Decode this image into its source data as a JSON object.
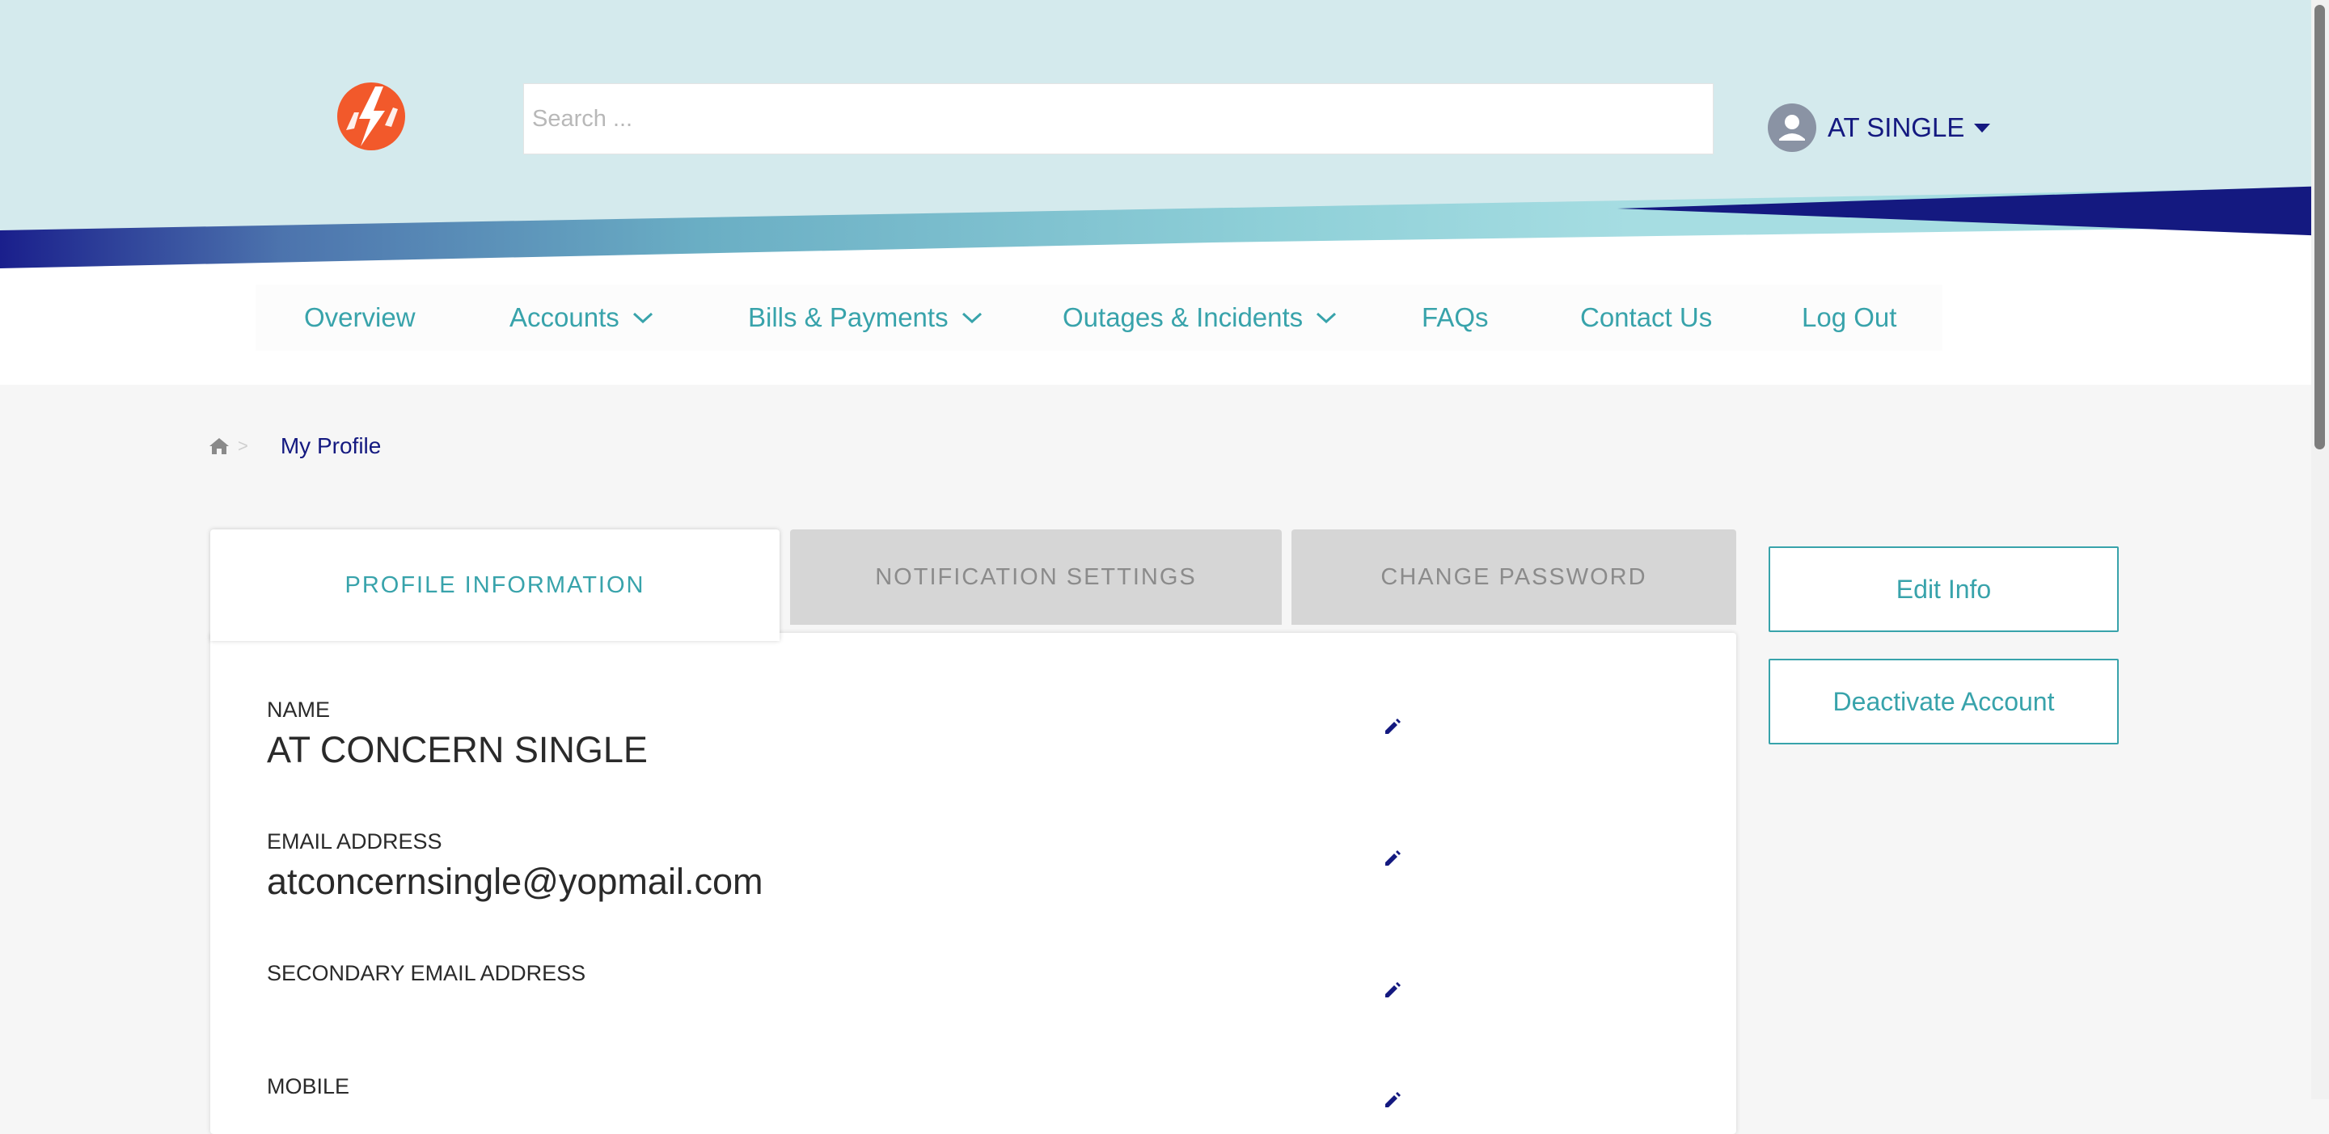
{
  "header": {
    "search_placeholder": "Search ...",
    "user_name": "AT SINGLE"
  },
  "nav": [
    {
      "label": "Overview",
      "has_dropdown": false
    },
    {
      "label": "Accounts",
      "has_dropdown": true
    },
    {
      "label": "Bills & Payments",
      "has_dropdown": true
    },
    {
      "label": "Outages & Incidents",
      "has_dropdown": true
    },
    {
      "label": "FAQs",
      "has_dropdown": false
    },
    {
      "label": "Contact Us",
      "has_dropdown": false
    },
    {
      "label": "Log Out",
      "has_dropdown": false
    }
  ],
  "breadcrumb": {
    "separator": ">",
    "current": "My Profile"
  },
  "tabs": [
    {
      "label": "PROFILE INFORMATION",
      "active": true
    },
    {
      "label": "NOTIFICATION SETTINGS",
      "active": false
    },
    {
      "label": "CHANGE PASSWORD",
      "active": false
    }
  ],
  "profile": {
    "fields": [
      {
        "label": "NAME",
        "value": "AT CONCERN SINGLE"
      },
      {
        "label": "EMAIL ADDRESS",
        "value": "atconcernsingle@yopmail.com"
      },
      {
        "label": "SECONDARY EMAIL ADDRESS",
        "value": ""
      },
      {
        "label": "MOBILE",
        "value": ""
      }
    ]
  },
  "actions": {
    "edit_info": "Edit Info",
    "deactivate": "Deactivate Account"
  },
  "colors": {
    "brand_navy": "#141980",
    "accent_teal": "#38a3ab",
    "header_bg": "#d4eaed",
    "logo_orange": "#f2592b"
  },
  "icons": [
    "logo-icon",
    "user-avatar-icon",
    "caret-down-icon",
    "chevron-down-icon",
    "home-icon",
    "pencil-icon"
  ]
}
